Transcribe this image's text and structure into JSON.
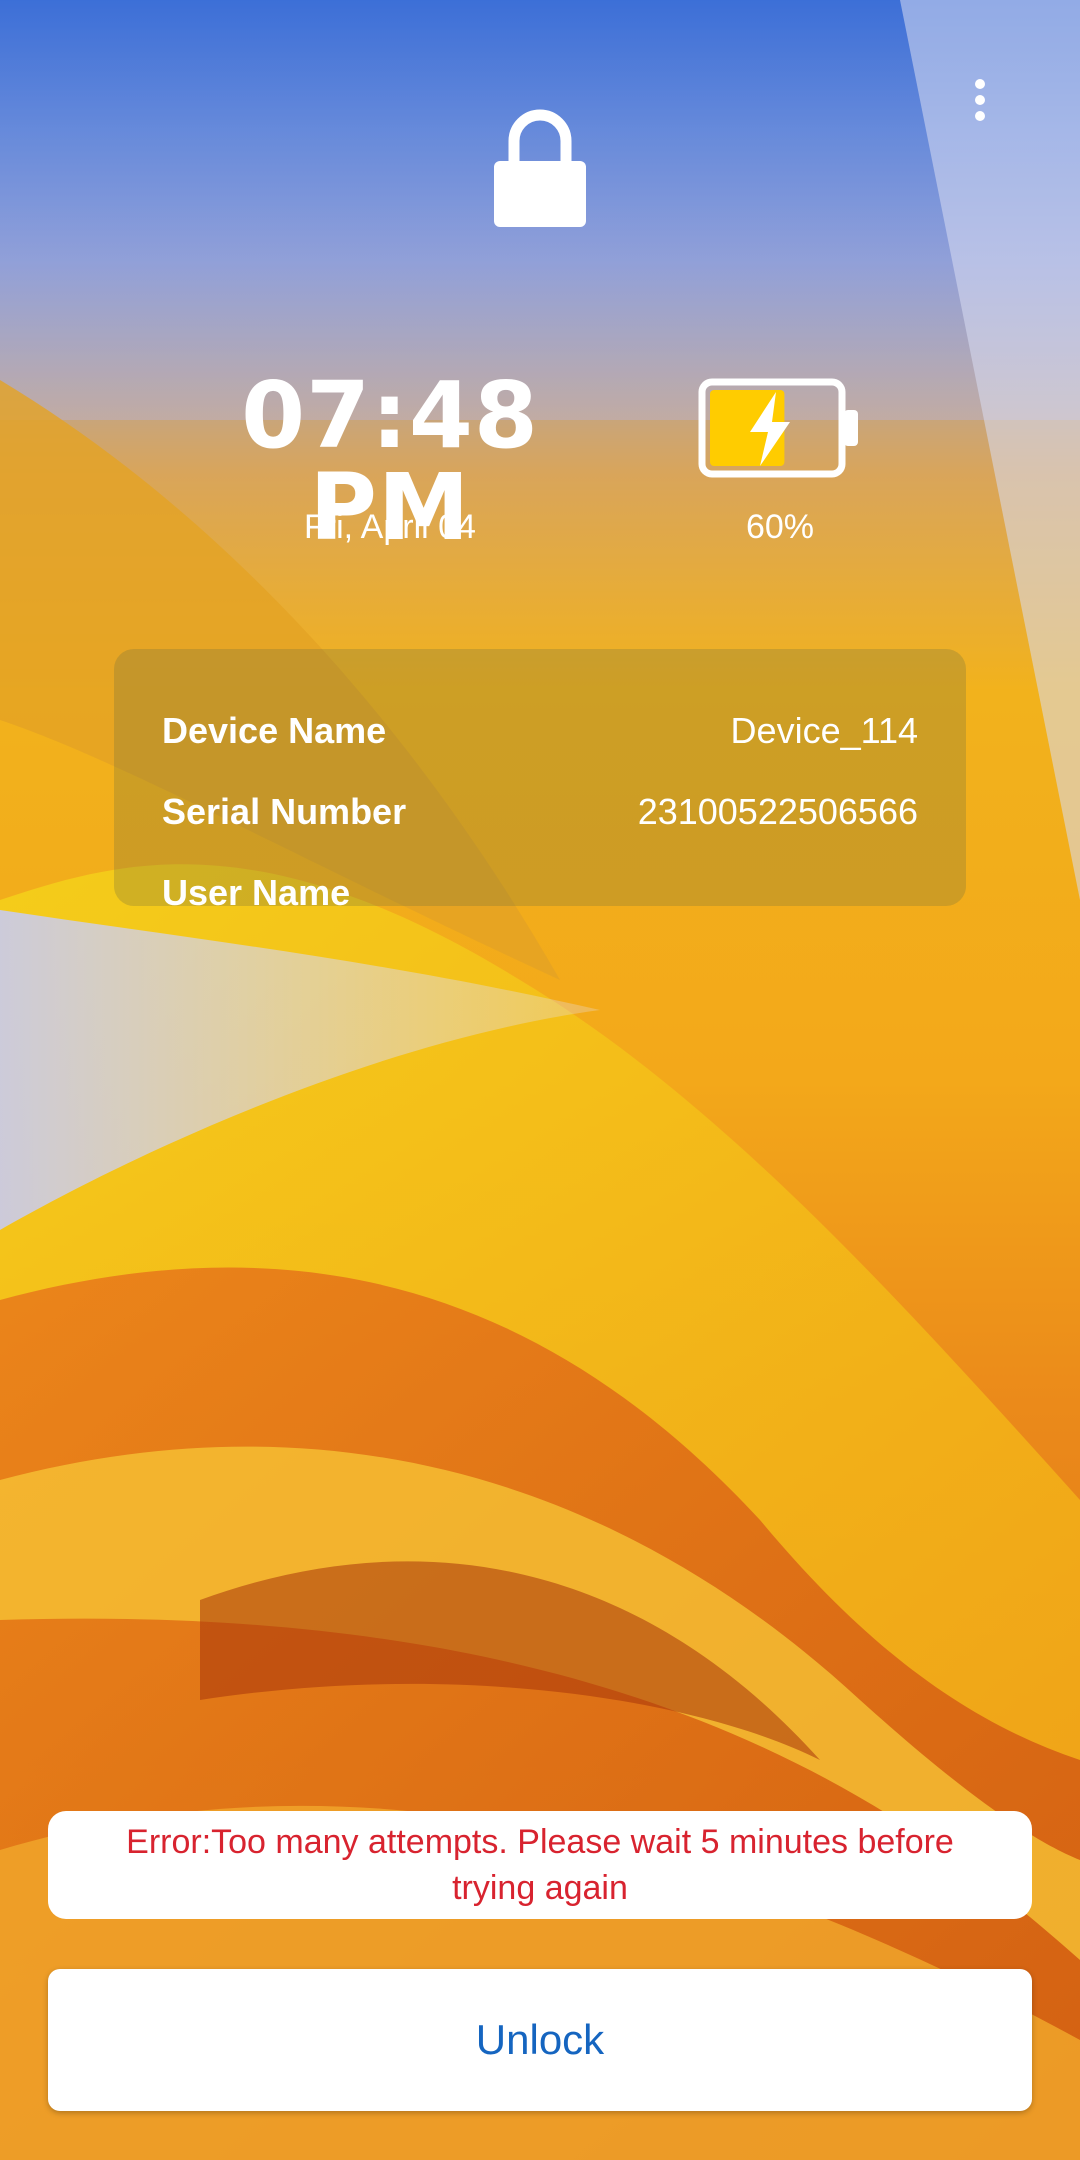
{
  "lock_screen": {
    "time": "07:48 PM",
    "date": "Fri, April 04",
    "battery": {
      "level_text": "60%",
      "level": 0.6,
      "charging": true,
      "fill_color": "#ffcc00"
    }
  },
  "device_info": {
    "rows": [
      {
        "label": "Device Name",
        "value": "Device_114"
      },
      {
        "label": "Serial Number",
        "value": "23100522506566"
      },
      {
        "label": "User Name",
        "value": ""
      }
    ]
  },
  "error": {
    "message": "Error:Too many attempts. Please wait 5 minutes before trying again",
    "color": "#d8232f"
  },
  "actions": {
    "unlock_label": "Unlock",
    "unlock_color": "#1565c0"
  },
  "icons": {
    "top": "lock-icon",
    "menu": "more-vert-icon",
    "battery": "battery-charging-icon"
  }
}
